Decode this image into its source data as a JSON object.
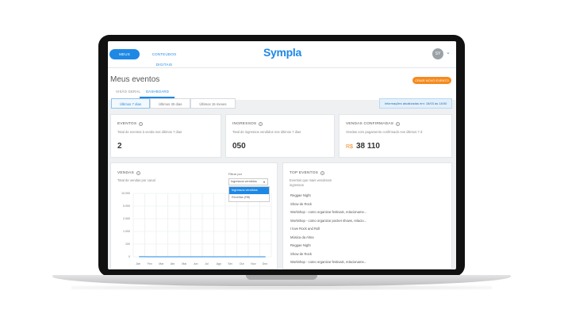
{
  "header": {
    "nav": [
      "MEUS EVENTOS",
      "CONTEÚDOS DIGITAIS"
    ],
    "logo": "Sympla",
    "avatar_initials": "SY",
    "page_title": "Meus eventos",
    "create_button": "CRIAR NOVO EVENTO",
    "tabs": [
      "VISÃO GERAL",
      "DASHBOARD"
    ]
  },
  "filters": {
    "periods": [
      "Últimos 7 dias",
      "Últimos 30 dias",
      "Últimos 15 meses"
    ],
    "updated_text": "Informações atualizadas em: 18/03 às 18:50"
  },
  "cards": {
    "eventos": {
      "title": "EVENTOS",
      "subtitle": "Total de eventos à venda nos últimos 7 dias",
      "value": "2"
    },
    "ingressos": {
      "title": "INGRESSOS",
      "subtitle": "Total de ingressos vendidos nos últimos 7 dias",
      "value": "050"
    },
    "vendas": {
      "title": "VENDAS CONFIRMADAS",
      "subtitle": "Vendas com pagamento confirmado nos últimos 7 d",
      "currency": "R$",
      "value": "38 110"
    }
  },
  "sales_chart": {
    "title": "VENDAS",
    "subtitle": "Total de vendas por canal",
    "filter_label": "Filtrar por",
    "select_value": "Ingressos vendidos",
    "options": [
      "Ingressos vendidos",
      "Receitas (R$)"
    ],
    "accent": "#1e88e5"
  },
  "chart_data": {
    "type": "line",
    "title": "VENDAS",
    "categories": [
      "Jan",
      "Fev",
      "Mar",
      "Abr",
      "Mai",
      "Jun",
      "Jul",
      "Ago",
      "Set",
      "Out",
      "Nov",
      "Dez"
    ],
    "y_ticks": [
      "10.000",
      "5.000",
      "2.000",
      "1.000",
      "100",
      "0"
    ],
    "series": [
      {
        "values": [
          10,
          0,
          0,
          0,
          0,
          0,
          0,
          0,
          0,
          0,
          0,
          0
        ]
      }
    ],
    "grid": true
  },
  "top_events": {
    "title": "TOP EVENTOS",
    "subtitle": "Eventos que mais venderam ingressos",
    "items": [
      "Reggae Night",
      "Show de Rock",
      "Workshop - como organizar festivais, relacioname...",
      "Workshop - como organizar pocket shows, relacio...",
      "I love Rock and Roll",
      "Música da Alma",
      "Reggae Night",
      "Show de Rock",
      "Workshop - como organizar festivais, relacioname..."
    ]
  }
}
